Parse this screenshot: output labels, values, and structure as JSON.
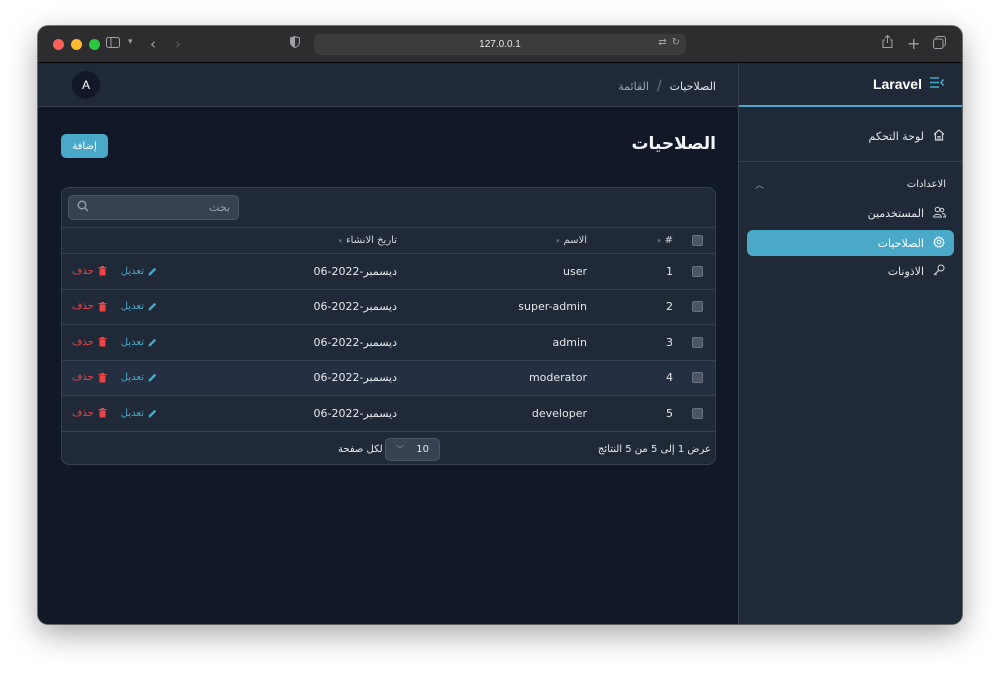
{
  "browser": {
    "url": "127.0.0.1"
  },
  "sidebar": {
    "brand": "Laravel",
    "dashboard": "لوحة التحكم",
    "group_title": "الاعدادات",
    "items": [
      {
        "label": "المستخدمين",
        "icon": "users-icon"
      },
      {
        "label": "الصلاحيات",
        "icon": "gear-icon",
        "active": true
      },
      {
        "label": "الاذونات",
        "icon": "key-icon"
      }
    ]
  },
  "topbar": {
    "avatar": "A",
    "breadcrumb_current": "الصلاحيات",
    "breadcrumb_sep": "/",
    "breadcrumb_link": "القائمة"
  },
  "page": {
    "title": "الصلاحيات",
    "add_label": "إضافة"
  },
  "table": {
    "search_placeholder": "بحث",
    "headers": {
      "num": "#",
      "name": "الاسم",
      "created": "تاريخ الانشاء"
    },
    "rows": [
      {
        "num": "1",
        "name": "user",
        "date": "06-ديسمبر-2022",
        "edit": "تعديل",
        "delete": "حذف"
      },
      {
        "num": "2",
        "name": "super-admin",
        "date": "06-ديسمبر-2022",
        "edit": "تعديل",
        "delete": "حذف"
      },
      {
        "num": "3",
        "name": "admin",
        "date": "06-ديسمبر-2022",
        "edit": "تعديل",
        "delete": "حذف"
      },
      {
        "num": "4",
        "name": "moderator",
        "date": "06-ديسمبر-2022",
        "edit": "تعديل",
        "delete": "حذف"
      },
      {
        "num": "5",
        "name": "developer",
        "date": "06-ديسمبر-2022",
        "edit": "تعديل",
        "delete": "حذف"
      }
    ],
    "results_text": "عرض 1 إلى 5 من 5 النتائج",
    "per_page_label": "لكل صفحة",
    "per_page_value": "10"
  },
  "colors": {
    "accent": "#4aa8c8",
    "danger": "#ef4444",
    "background": "#111827",
    "surface": "#1f2937"
  }
}
